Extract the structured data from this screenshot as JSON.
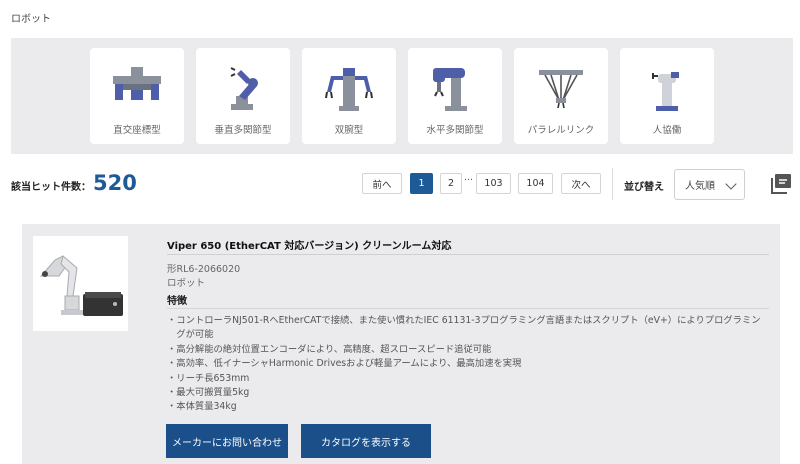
{
  "breadcrumb": "ロボット",
  "categories": [
    {
      "label": "直交座標型",
      "icon": "cartesian-robot-icon"
    },
    {
      "label": "垂直多関節型",
      "icon": "articulated-robot-icon"
    },
    {
      "label": "双腕型",
      "icon": "dual-arm-robot-icon"
    },
    {
      "label": "水平多関節型",
      "icon": "scara-robot-icon"
    },
    {
      "label": "パラレルリンク",
      "icon": "parallel-link-robot-icon"
    },
    {
      "label": "人協働",
      "icon": "collaborative-robot-icon"
    }
  ],
  "results": {
    "label": "該当ヒット件数：",
    "count": "520"
  },
  "pagination": {
    "prev": "前へ",
    "pages": [
      "1",
      "2",
      "103",
      "104"
    ],
    "current": "1",
    "ellipsis": "…",
    "next": "次へ"
  },
  "sort": {
    "label": "並び替え",
    "selected": "人気順"
  },
  "product": {
    "title": "Viper 650 (EtherCAT 対応バージョン) クリーンルーム対応",
    "model": "形RL6-2066020",
    "category": "ロボット",
    "features_title": "特徴",
    "features": [
      "・コントローラNJ501-RへEtherCATで接続、また使い慣れたIEC 61131-3プログラミング言語またはスクリプト（eV+）によりプログラミン",
      "　グが可能",
      "・高分解能の絶対位置エンコーダにより、高精度、超スロースピード追従可能",
      "・高効率、低イナーシャHarmonic Drivesおよび軽量アームにより、最高加速を実現",
      "・リーチ長653mm",
      "・最大可搬質量5kg",
      "・本体質量34kg"
    ],
    "contact_button": "メーカーにお問い合わせ",
    "catalog_button": "カタログを表示する"
  },
  "colors": {
    "accent": "#1d5a96",
    "panel": "#ebebee",
    "button": "#1a4f8a",
    "robot_blue": "#4f5ea8",
    "robot_grey": "#8a909c"
  }
}
